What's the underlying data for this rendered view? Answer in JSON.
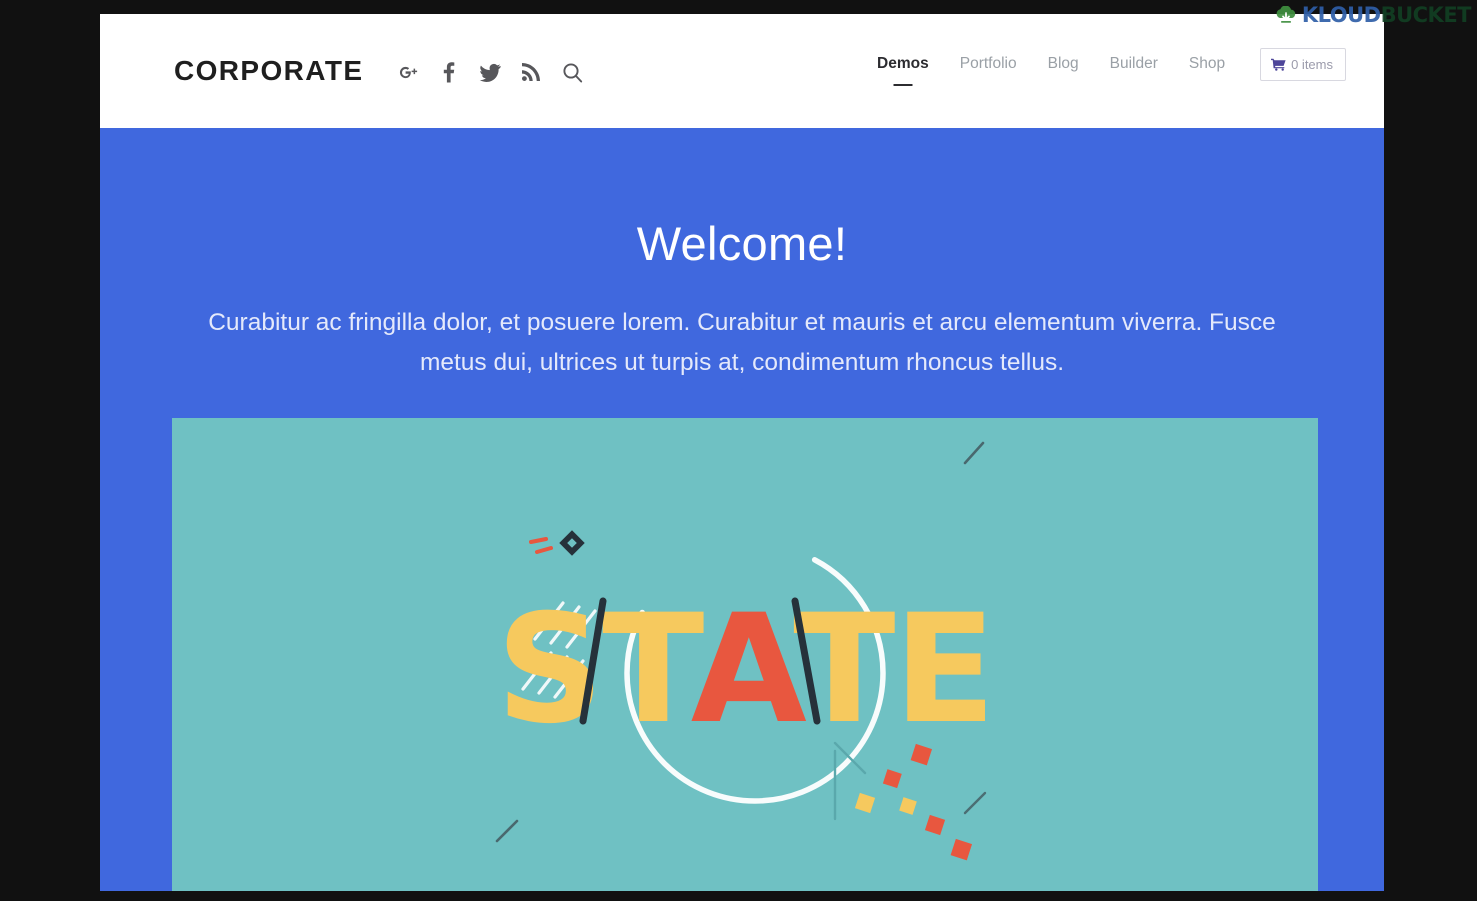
{
  "watermark": {
    "icon": "cloud-download-icon",
    "text_primary": "KLOUD",
    "text_secondary": "BUCKET",
    "color_primary": "#2f5fa8",
    "color_secondary": "#123f23",
    "icon_color": "#3f8f3f"
  },
  "header": {
    "logo": "CORPORATE",
    "social_icons": [
      {
        "name": "google-plus-icon",
        "label": "Google Plus"
      },
      {
        "name": "facebook-icon",
        "label": "Facebook"
      },
      {
        "name": "twitter-icon",
        "label": "Twitter"
      },
      {
        "name": "rss-icon",
        "label": "RSS"
      },
      {
        "name": "search-icon",
        "label": "Search"
      }
    ],
    "nav": [
      {
        "label": "Demos",
        "active": true
      },
      {
        "label": "Portfolio",
        "active": false
      },
      {
        "label": "Blog",
        "active": false
      },
      {
        "label": "Builder",
        "active": false
      },
      {
        "label": "Shop",
        "active": false
      }
    ],
    "cart": {
      "icon": "shopping-cart-icon",
      "label": "0 items",
      "count": 0,
      "icon_color": "#4d4599"
    }
  },
  "hero": {
    "background_color": "#4068de",
    "title": "Welcome!",
    "subtitle": "Curabitur ac fringilla dolor, et posuere lorem. Curabitur et mauris et arcu elementum viverra. Fusce metus dui, ultrices ut turpis at, condimentum rhoncus tellus."
  },
  "showcase": {
    "background_color": "#6fc1c3",
    "artwork_word": "STATE",
    "artwork_letters": [
      {
        "char": "S",
        "color": "#f6c95e"
      },
      {
        "char": "T",
        "color": "#f6c95e"
      },
      {
        "char": "A",
        "color": "#e8573f"
      },
      {
        "char": "T",
        "color": "#f6c95e"
      },
      {
        "char": "E",
        "color": "#f6c95e"
      }
    ],
    "accent_colors": {
      "yellow": "#f6c95e",
      "orange_red": "#e8573f",
      "white_arc": "#ffffff",
      "dark_stroke": "#26313a"
    }
  },
  "page": {
    "background_color": "#ffffff",
    "outer_background_color": "#111111"
  }
}
